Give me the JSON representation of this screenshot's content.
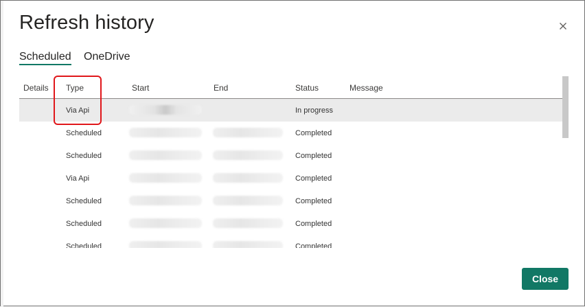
{
  "dialog": {
    "title": "Refresh history",
    "close_icon": "close-icon"
  },
  "tabs": [
    {
      "label": "Scheduled",
      "active": true
    },
    {
      "label": "OneDrive",
      "active": false
    }
  ],
  "table": {
    "columns": [
      "Details",
      "Type",
      "Start",
      "End",
      "Status",
      "Message"
    ],
    "rows": [
      {
        "type": "Via Api",
        "start": "",
        "end": "",
        "status": "In progress",
        "message": "",
        "selected": true
      },
      {
        "type": "Scheduled",
        "start": "",
        "end": "",
        "status": "Completed",
        "message": ""
      },
      {
        "type": "Scheduled",
        "start": "",
        "end": "",
        "status": "Completed",
        "message": ""
      },
      {
        "type": "Via Api",
        "start": "",
        "end": "",
        "status": "Completed",
        "message": ""
      },
      {
        "type": "Scheduled",
        "start": "",
        "end": "",
        "status": "Completed",
        "message": ""
      },
      {
        "type": "Scheduled",
        "start": "",
        "end": "",
        "status": "Completed",
        "message": ""
      },
      {
        "type": "Scheduled",
        "start": "",
        "end": "",
        "status": "Completed",
        "message": ""
      }
    ]
  },
  "footer": {
    "close_label": "Close"
  },
  "colors": {
    "accent": "#117865",
    "highlight": "#e0161a",
    "selected_row": "#ebebeb"
  }
}
